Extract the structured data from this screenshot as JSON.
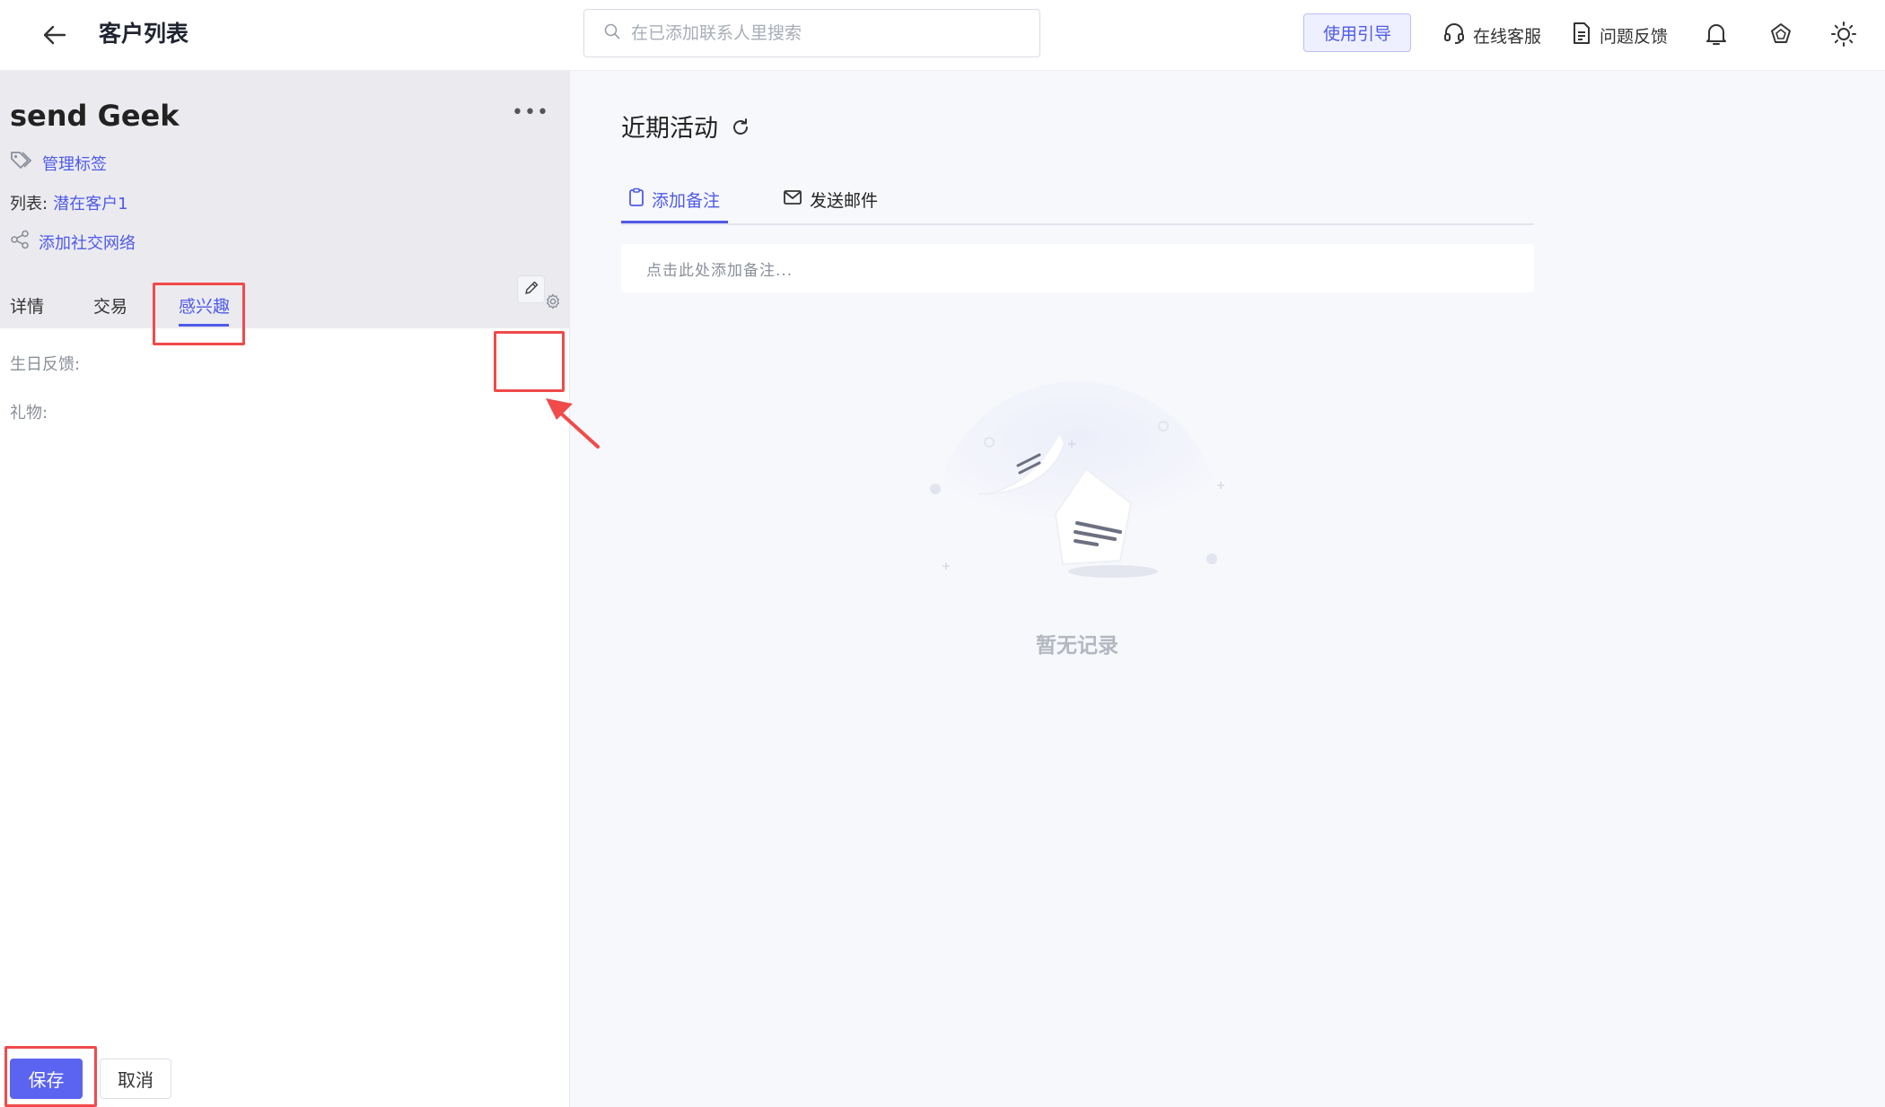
{
  "header": {
    "title": "客户列表",
    "search_placeholder": "在已添加联系人里搜索",
    "guide_label": "使用引导",
    "support_label": "在线客服",
    "feedback_label": "问题反馈"
  },
  "contact": {
    "name": "send Geek",
    "manage_tags_label": "管理标签",
    "list_prefix": "列表:",
    "list_value": "潜在客户1",
    "add_social_label": "添加社交网络"
  },
  "left_tabs": {
    "details": "详情",
    "deals": "交易",
    "interests": "感兴趣"
  },
  "interest_fields": {
    "birthday_feedback": "生日反馈:",
    "gift": "礼物:"
  },
  "actions": {
    "save": "保存",
    "cancel": "取消"
  },
  "activity": {
    "title": "近期活动",
    "tab_note": "添加备注",
    "tab_email": "发送邮件",
    "note_placeholder": "点击此处添加备注...",
    "empty_text": "暂无记录"
  },
  "colors": {
    "accent": "#4f5ae8",
    "primary_button": "#5b64f0",
    "annotation_red": "#f04a4a",
    "header_bg": "#ebebef"
  },
  "icons": [
    "back-arrow-icon",
    "search-icon",
    "headset-icon",
    "document-icon",
    "bell-icon",
    "pentagon-icon",
    "sun-icon",
    "tag-icon",
    "share-icon",
    "gear-icon",
    "pencil-icon",
    "refresh-icon",
    "clipboard-icon",
    "mail-icon"
  ]
}
